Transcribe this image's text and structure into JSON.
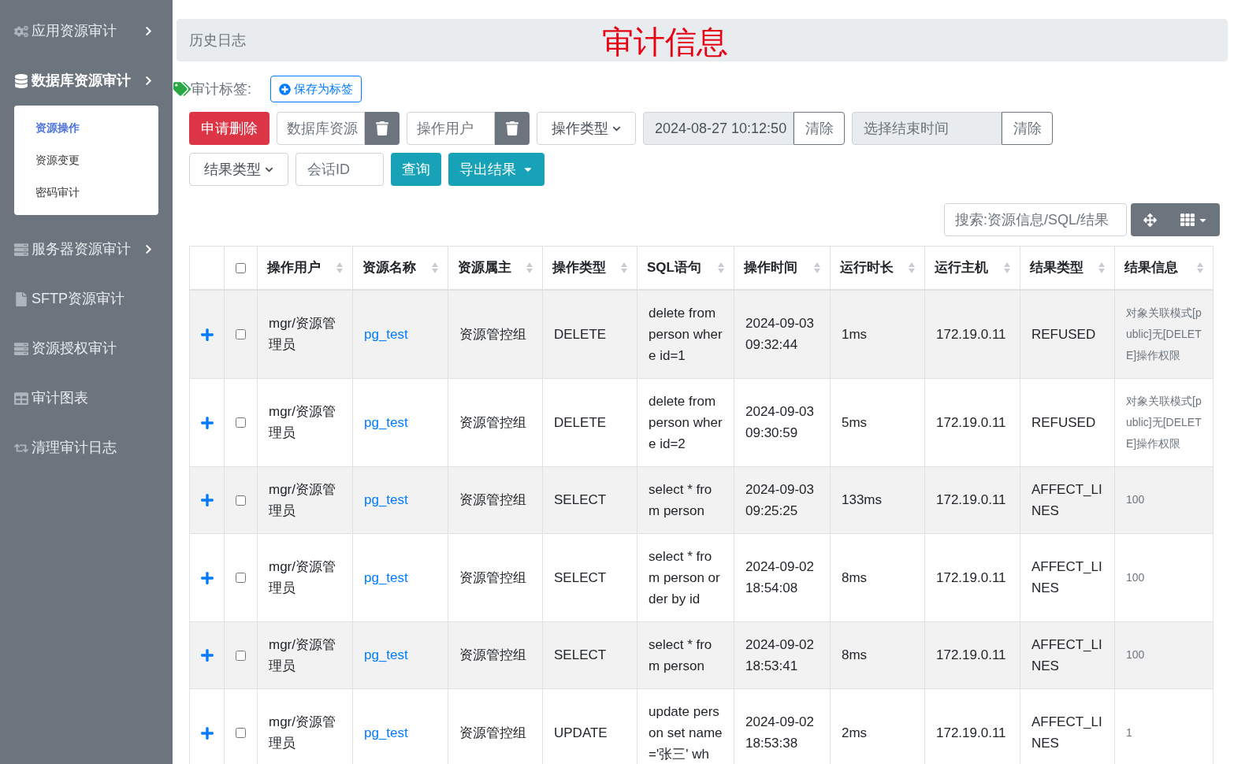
{
  "sidebar": {
    "items": [
      {
        "label": "应用资源审计",
        "expandable": true,
        "expanded": false
      },
      {
        "label": "数据库资源审计",
        "expandable": true,
        "expanded": true,
        "children": [
          {
            "label": "资源操作",
            "selected": true
          },
          {
            "label": "资源变更",
            "selected": false
          },
          {
            "label": "密码审计",
            "selected": false
          }
        ]
      },
      {
        "label": "服务器资源审计",
        "expandable": true,
        "expanded": false
      },
      {
        "label": "SFTP资源审计",
        "expandable": false,
        "expanded": false
      },
      {
        "label": "资源授权审计",
        "expandable": false,
        "expanded": false
      },
      {
        "label": "审计图表",
        "expandable": false,
        "expanded": false
      },
      {
        "label": "清理审计日志",
        "expandable": false,
        "expanded": false
      }
    ]
  },
  "header": {
    "breadcrumb": "历史日志",
    "title": "审计信息"
  },
  "tag_bar": {
    "label": "审计标签:",
    "save_button": "保存为标签"
  },
  "filters": {
    "delete_button": "申请删除",
    "resource_placeholder": "数据库资源",
    "user_placeholder": "操作用户",
    "op_type_select": "操作类型",
    "start_time": "2024-08-27 10:12:50",
    "start_clear": "清除",
    "end_placeholder": "选择结束时间",
    "end_clear": "清除",
    "result_type_select": "结果类型",
    "session_placeholder": "会话ID",
    "query_button": "查询",
    "export_button": "导出结果"
  },
  "search": {
    "placeholder": "搜索:资源信息/SQL/结果"
  },
  "table": {
    "columns": [
      "操作用户",
      "资源名称",
      "资源属主",
      "操作类型",
      "SQL语句",
      "操作时间",
      "运行时长",
      "运行主机",
      "结果类型",
      "结果信息"
    ],
    "header_checked": false,
    "rows": [
      {
        "checked": false,
        "cells": [
          "mgr/资源管理员",
          "pg_test",
          "资源管控组",
          "DELETE",
          "delete from person where id=1",
          "2024-09-03 09:32:44",
          "1ms",
          "172.19.0.11",
          "REFUSED",
          "对象关联模式[public]无[DELETE]操作权限"
        ]
      },
      {
        "checked": false,
        "cells": [
          "mgr/资源管理员",
          "pg_test",
          "资源管控组",
          "DELETE",
          "delete from person where id=2",
          "2024-09-03 09:30:59",
          "5ms",
          "172.19.0.11",
          "REFUSED",
          "对象关联模式[public]无[DELETE]操作权限"
        ]
      },
      {
        "checked": false,
        "cells": [
          "mgr/资源管理员",
          "pg_test",
          "资源管控组",
          "SELECT",
          "select * from person",
          "2024-09-03 09:25:25",
          "133ms",
          "172.19.0.11",
          "AFFECT_LINES",
          "100"
        ]
      },
      {
        "checked": false,
        "cells": [
          "mgr/资源管理员",
          "pg_test",
          "资源管控组",
          "SELECT",
          "select * from person order by id",
          "2024-09-02 18:54:08",
          "8ms",
          "172.19.0.11",
          "AFFECT_LINES",
          "100"
        ]
      },
      {
        "checked": false,
        "cells": [
          "mgr/资源管理员",
          "pg_test",
          "资源管控组",
          "SELECT",
          "select * from person",
          "2024-09-02 18:53:41",
          "8ms",
          "172.19.0.11",
          "AFFECT_LINES",
          "100"
        ]
      },
      {
        "checked": false,
        "cells": [
          "mgr/资源管理员",
          "pg_test",
          "资源管控组",
          "UPDATE",
          "update person set name='张三' wh",
          "2024-09-02 18:53:38",
          "2ms",
          "172.19.0.11",
          "AFFECT_LINES",
          "1"
        ]
      }
    ]
  }
}
